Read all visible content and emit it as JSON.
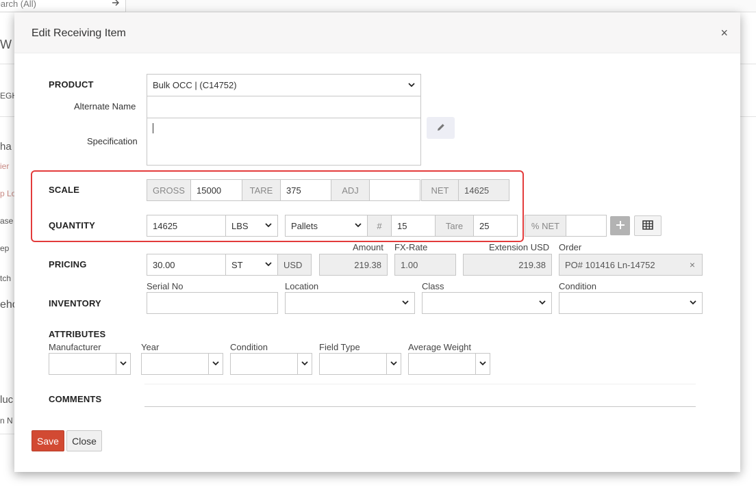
{
  "background": {
    "search_placeholder": "Search (All)",
    "fragments": [
      "W",
      "EGH",
      "ha",
      "ier",
      "p Lo",
      "ase",
      "ep",
      "tch",
      "eho",
      "luc",
      "n N"
    ]
  },
  "modal": {
    "title": "Edit Receiving Item",
    "close_glyph": "×"
  },
  "product": {
    "section_label": "PRODUCT",
    "selected": "Bulk OCC | (C14752)",
    "alternate_name_label": "Alternate Name",
    "alternate_name_value": "",
    "specification_label": "Specification",
    "specification_value": ""
  },
  "scale": {
    "section_label": "SCALE",
    "gross_label": "GROSS",
    "gross_value": "15000",
    "tare_label": "TARE",
    "tare_value": "375",
    "adj_label": "ADJ",
    "adj_value": "",
    "net_label": "NET",
    "net_value": "14625"
  },
  "quantity": {
    "section_label": "QUANTITY",
    "value": "14625",
    "unit": "LBS",
    "container": "Pallets",
    "count_label": "#",
    "count_value": "15",
    "tare_label": "Tare",
    "tare_value": "25",
    "pct_net_label": "% NET",
    "pct_net_value": ""
  },
  "pricing": {
    "section_label": "PRICING",
    "price": "30.00",
    "unit": "ST",
    "currency": "USD",
    "amount_label": "Amount",
    "amount_value": "219.38",
    "fx_label": "FX-Rate",
    "fx_value": "1.00",
    "extension_label": "Extension USD",
    "extension_value": "219.38",
    "order_label": "Order",
    "order_value": "PO# 101416 Ln-14752"
  },
  "inventory": {
    "section_label": "INVENTORY",
    "serial_label": "Serial No",
    "serial_value": "",
    "location_label": "Location",
    "location_value": "",
    "class_label": "Class",
    "class_value": "",
    "condition_label": "Condition",
    "condition_value": ""
  },
  "attributes": {
    "section_label": "ATTRIBUTES",
    "manufacturer_label": "Manufacturer",
    "year_label": "Year",
    "condition_label": "Condition",
    "field_type_label": "Field Type",
    "average_weight_label": "Average Weight"
  },
  "comments": {
    "section_label": "COMMENTS",
    "value": ""
  },
  "footer": {
    "save_label": "Save",
    "close_label": "Close"
  },
  "colors": {
    "highlight": "#e33b3b",
    "save_button": "#d24a33",
    "plus_button": "#b3b3b3"
  },
  "icons": {
    "edit": "pencil-icon",
    "add": "plus-icon",
    "grid": "grid-icon",
    "caret": "chevron-down-icon",
    "search_go": "arrow-right-icon"
  }
}
